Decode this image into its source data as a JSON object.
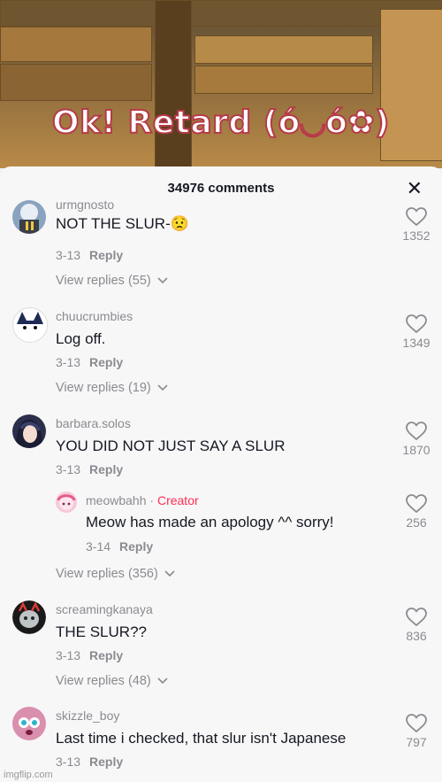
{
  "video": {
    "caption": "Ok! Retard (ό◡ό✿)"
  },
  "header": {
    "comment_count": "34976 comments",
    "close_label": "✕"
  },
  "comments": [
    {
      "username": "urmgnosto",
      "text": "NOT THE SLUR-😟",
      "date": "3-13",
      "reply_label": "Reply",
      "likes": "1352",
      "view_replies": "View replies (55)"
    },
    {
      "username": "chuucrumbies",
      "text": "Log off.",
      "date": "3-13",
      "reply_label": "Reply",
      "likes": "1349",
      "view_replies": "View replies (19)"
    },
    {
      "username": "barbara.solos",
      "text": "YOU DID NOT JUST SAY A SLUR",
      "date": "3-13",
      "reply_label": "Reply",
      "likes": "1870",
      "view_replies": "View replies (356)"
    },
    {
      "username": "screamingkanaya",
      "text": "THE SLUR??",
      "date": "3-13",
      "reply_label": "Reply",
      "likes": "836",
      "view_replies": "View replies (48)"
    },
    {
      "username": "skizzle_boy",
      "text": "Last time i checked, that slur isn't Japanese",
      "date": "3-13",
      "reply_label": "Reply",
      "likes": "797"
    }
  ],
  "creator_reply": {
    "username": "meowbahh",
    "separator": "·",
    "badge": "Creator",
    "text": "Meow has made an apology ^^ sorry!",
    "date": "3-14",
    "reply_label": "Reply",
    "likes": "256"
  },
  "watermark": "imgflip.com",
  "icons": {
    "like": "heart-outline-icon",
    "expand": "chevron-down-icon"
  },
  "colors": {
    "creator_badge": "#fe2c55",
    "muted": "#8a8b91"
  }
}
